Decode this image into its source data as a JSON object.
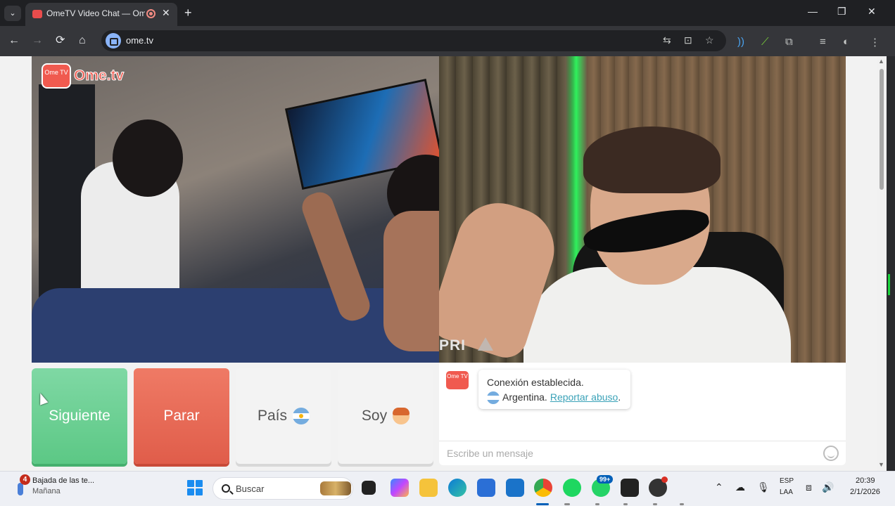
{
  "browser": {
    "tab_title": "OmeTV Video Chat — Ome",
    "tab_close": "✕",
    "new_tab": "+",
    "tab_list": "⌄",
    "window_controls": {
      "minimize": "—",
      "restore": "❐",
      "close": "✕"
    },
    "nav": {
      "back": "←",
      "forward": "→",
      "reload": "⟳",
      "home": "⌂"
    },
    "url": "ome.tv",
    "omnibox_icons": [
      "translate-icon",
      "install-app-icon",
      "bookmark-star-icon"
    ],
    "extensions": [
      "audio-extension-icon",
      "green-leaf-extension-icon",
      "puzzle-extensions-icon",
      "media-control-icon",
      "profile-avatar-icon",
      "more-menu-icon"
    ]
  },
  "ometv": {
    "logo_badge": "Ome TV",
    "logo_text": "Ome.tv",
    "watermark": "PRI",
    "buttons": {
      "next": "Siguiente",
      "stop": "Parar",
      "country": "País",
      "gender": "Soy"
    },
    "chat": {
      "logo_badge": "Ome TV",
      "status": "Conexión establecida.",
      "country": "Argentina.",
      "report_link": "Reportar abuso",
      "report_suffix": ".",
      "placeholder": "Escribe un mensaje"
    }
  },
  "taskbar": {
    "weather_badge": "4",
    "weather_title": "Bajada de las te...",
    "weather_subtitle": "Mañana",
    "search_placeholder": "Buscar",
    "whatsapp_badge": "99+",
    "apps": [
      "task-view-icon",
      "copilot-icon",
      "file-explorer-icon",
      "edge-icon",
      "store-icon",
      "outlook-icon",
      "chrome-icon",
      "spotify-icon",
      "whatsapp-icon",
      "camera-app-icon",
      "recording-app-icon"
    ],
    "tray": {
      "overflow": "⌃",
      "lang_line1": "ESP",
      "lang_line2": "LAA",
      "time": "20:39",
      "date": "2/1/2026"
    }
  },
  "colors": {
    "next_button": "#5cc885",
    "stop_button": "#e05d4a",
    "ometv_red": "#f05a4f",
    "report_link": "#3aa2b8"
  }
}
